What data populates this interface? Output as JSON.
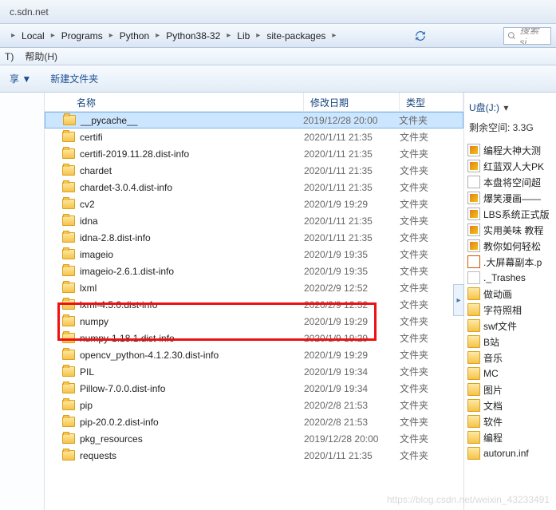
{
  "tab": "c.sdn.net",
  "breadcrumb": [
    "Local",
    "Programs",
    "Python",
    "Python38-32",
    "Lib",
    "site-packages"
  ],
  "search_placeholder": "搜索 si",
  "menubar": {
    "item_t": "T)",
    "item_help": "帮助(H)"
  },
  "toolbar": {
    "share": "享 ▼",
    "newfolder": "新建文件夹"
  },
  "columns": {
    "name": "名称",
    "date": "修改日期",
    "type": "类型"
  },
  "files": [
    {
      "name": "__pycache__",
      "date": "2019/12/28 20:00",
      "type": "文件夹",
      "sel": true
    },
    {
      "name": "certifi",
      "date": "2020/1/11 21:35",
      "type": "文件夹"
    },
    {
      "name": "certifi-2019.11.28.dist-info",
      "date": "2020/1/11 21:35",
      "type": "文件夹"
    },
    {
      "name": "chardet",
      "date": "2020/1/11 21:35",
      "type": "文件夹"
    },
    {
      "name": "chardet-3.0.4.dist-info",
      "date": "2020/1/11 21:35",
      "type": "文件夹"
    },
    {
      "name": "cv2",
      "date": "2020/1/9 19:29",
      "type": "文件夹"
    },
    {
      "name": "idna",
      "date": "2020/1/11 21:35",
      "type": "文件夹"
    },
    {
      "name": "idna-2.8.dist-info",
      "date": "2020/1/11 21:35",
      "type": "文件夹"
    },
    {
      "name": "imageio",
      "date": "2020/1/9 19:35",
      "type": "文件夹"
    },
    {
      "name": "imageio-2.6.1.dist-info",
      "date": "2020/1/9 19:35",
      "type": "文件夹"
    },
    {
      "name": "lxml",
      "date": "2020/2/9 12:52",
      "type": "文件夹"
    },
    {
      "name": "lxml-4.5.0.dist-info",
      "date": "2020/2/9 12:52",
      "type": "文件夹"
    },
    {
      "name": "numpy",
      "date": "2020/1/9 19:29",
      "type": "文件夹"
    },
    {
      "name": "numpy-1.18.1.dist-info",
      "date": "2020/1/9 19:29",
      "type": "文件夹"
    },
    {
      "name": "opencv_python-4.1.2.30.dist-info",
      "date": "2020/1/9 19:29",
      "type": "文件夹"
    },
    {
      "name": "PIL",
      "date": "2020/1/9 19:34",
      "type": "文件夹"
    },
    {
      "name": "Pillow-7.0.0.dist-info",
      "date": "2020/1/9 19:34",
      "type": "文件夹"
    },
    {
      "name": "pip",
      "date": "2020/2/8 21:53",
      "type": "文件夹"
    },
    {
      "name": "pip-20.0.2.dist-info",
      "date": "2020/2/8 21:53",
      "type": "文件夹"
    },
    {
      "name": "pkg_resources",
      "date": "2019/12/28 20:00",
      "type": "文件夹"
    },
    {
      "name": "requests",
      "date": "2020/1/11 21:35",
      "type": "文件夹"
    }
  ],
  "sidepanel": {
    "title": "U盘(J:)",
    "freespace": "剩余空间: 3.3G",
    "items": [
      {
        "name": "编程大神大测",
        "ico": "img"
      },
      {
        "name": "红蓝双人大PK",
        "ico": "img"
      },
      {
        "name": "本盘将空间超",
        "ico": "doc"
      },
      {
        "name": "爆笑漫画——",
        "ico": "img"
      },
      {
        "name": "LBS系统正式版",
        "ico": "img"
      },
      {
        "name": "实用美味 教程",
        "ico": "img"
      },
      {
        "name": "教你如何轻松",
        "ico": "img"
      },
      {
        "name": ".大屏幕副本.p",
        "ico": "p"
      },
      {
        "name": "._Trashes",
        "ico": "file"
      },
      {
        "name": "做动画",
        "ico": "fld"
      },
      {
        "name": "字符照相",
        "ico": "fld"
      },
      {
        "name": "swf文件",
        "ico": "fld"
      },
      {
        "name": "B站",
        "ico": "fld"
      },
      {
        "name": "音乐",
        "ico": "fld"
      },
      {
        "name": "MC",
        "ico": "fld"
      },
      {
        "name": "图片",
        "ico": "fld"
      },
      {
        "name": "文档",
        "ico": "fld"
      },
      {
        "name": "软件",
        "ico": "fld"
      },
      {
        "name": "编程",
        "ico": "fld"
      },
      {
        "name": "autorun.inf",
        "ico": "fld"
      }
    ]
  },
  "watermark": "https://blog.csdn.net/weixin_43233491"
}
